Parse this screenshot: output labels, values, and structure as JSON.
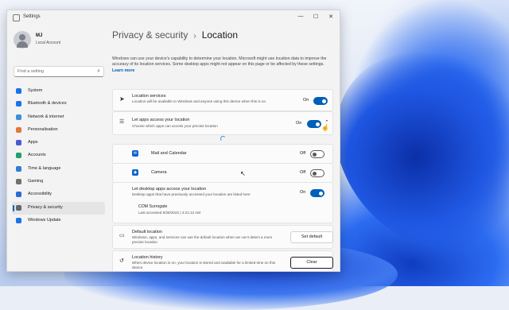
{
  "window": {
    "title": "Settings",
    "controls": {
      "minimize": "—",
      "maximize": "☐",
      "close": "✕"
    }
  },
  "profile": {
    "name": "MJ",
    "account_type": "Local Account"
  },
  "search": {
    "placeholder": "Find a setting",
    "icon": "search-icon"
  },
  "sidebar": {
    "items": [
      {
        "label": "System",
        "icon": "system-icon",
        "color": "#1a73e8"
      },
      {
        "label": "Bluetooth & devices",
        "icon": "bluetooth-icon",
        "color": "#1a73e8"
      },
      {
        "label": "Network & internet",
        "icon": "network-icon",
        "color": "#3a8fe0"
      },
      {
        "label": "Personalisation",
        "icon": "brush-icon",
        "color": "#e0783a"
      },
      {
        "label": "Apps",
        "icon": "apps-icon",
        "color": "#4a5ad4"
      },
      {
        "label": "Accounts",
        "icon": "accounts-icon",
        "color": "#22a06b"
      },
      {
        "label": "Time & language",
        "icon": "globe-clock-icon",
        "color": "#2b7fd4"
      },
      {
        "label": "Gaming",
        "icon": "gaming-icon",
        "color": "#707070"
      },
      {
        "label": "Accessibility",
        "icon": "accessibility-icon",
        "color": "#2b6cd4"
      },
      {
        "label": "Privacy & security",
        "icon": "shield-icon",
        "color": "#606870",
        "active": true
      },
      {
        "label": "Windows Update",
        "icon": "update-icon",
        "color": "#1a73e8"
      }
    ]
  },
  "breadcrumb": {
    "parent": "Privacy & security",
    "separator": "›",
    "current": "Location"
  },
  "description": {
    "text": "Windows can use your device's capability to determine your location. Microsoft might use location data to improve the accuracy of its location services. Some desktop apps might not appear on this page or be affected by these settings.",
    "link": "Learn more"
  },
  "location_services": {
    "title": "Location services",
    "subtitle": "Location will be available to Windows and anyone using this device when this is on",
    "state": "On"
  },
  "apps_access": {
    "title": "Let apps access your location",
    "subtitle": "Choose which apps can access your precise location",
    "state": "On"
  },
  "apps": [
    {
      "name": "Mail and Calendar",
      "state": "Off",
      "icon": "mail-calendar-icon"
    },
    {
      "name": "Camera",
      "state": "Off",
      "icon": "camera-icon"
    }
  ],
  "desktop_apps": {
    "title": "Let desktop apps access your location",
    "subtitle": "Desktop apps that have previously accessed your location are listed here",
    "state": "On",
    "entry": {
      "name": "COM Surrogate",
      "last_accessed": "Last accessed 8/28/2022  |  4:21:12 AM"
    }
  },
  "default_location": {
    "title": "Default location",
    "subtitle": "Windows, apps, and services can use the default location when we can't detect a more precise location",
    "button": "Set default"
  },
  "location_history": {
    "title": "Location history",
    "subtitle": "When device location is on, your location is stored and available for a limited time on this device",
    "button": "Clear"
  }
}
